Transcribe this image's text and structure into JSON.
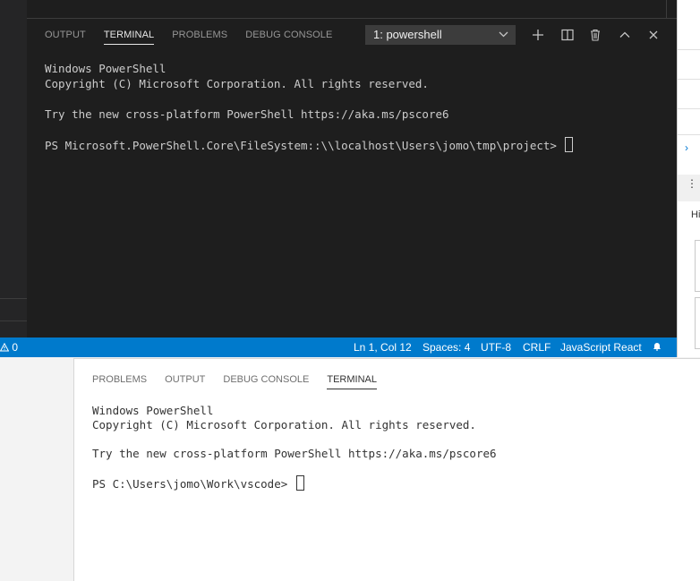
{
  "top_window": {
    "panel_tabs": [
      {
        "label": "OUTPUT",
        "active": false
      },
      {
        "label": "TERMINAL",
        "active": true
      },
      {
        "label": "PROBLEMS",
        "active": false
      },
      {
        "label": "DEBUG CONSOLE",
        "active": false
      }
    ],
    "terminal_select": {
      "value": "1: powershell"
    },
    "terminal_lines": [
      "Windows PowerShell",
      "Copyright (C) Microsoft Corporation. All rights reserved.",
      "",
      "Try the new cross-platform PowerShell https://aka.ms/pscore6",
      ""
    ],
    "prompt": "PS Microsoft.PowerShell.Core\\FileSystem::\\\\localhost\\Users\\jomo\\tmp\\project> "
  },
  "statusbar": {
    "warnings_count": "0",
    "position": "Ln 1, Col 12",
    "spaces": "Spaces: 4",
    "encoding": "UTF-8",
    "eol": "CRLF",
    "language": "JavaScript React"
  },
  "right_strip": {
    "label_fragment": "Hi"
  },
  "bottom_window": {
    "panel_tabs": [
      {
        "label": "PROBLEMS",
        "active": false
      },
      {
        "label": "OUTPUT",
        "active": false
      },
      {
        "label": "DEBUG CONSOLE",
        "active": false
      },
      {
        "label": "TERMINAL",
        "active": true
      }
    ],
    "terminal_lines": [
      "Windows PowerShell",
      "Copyright (C) Microsoft Corporation. All rights reserved.",
      "",
      "Try the new cross-platform PowerShell https://aka.ms/pscore6",
      ""
    ],
    "prompt": "PS C:\\Users\\jomo\\Work\\vscode> "
  },
  "colors": {
    "statusbar_bg": "#007acc",
    "dark_panel_bg": "#1e1e1e",
    "light_panel_bg": "#ffffff"
  }
}
